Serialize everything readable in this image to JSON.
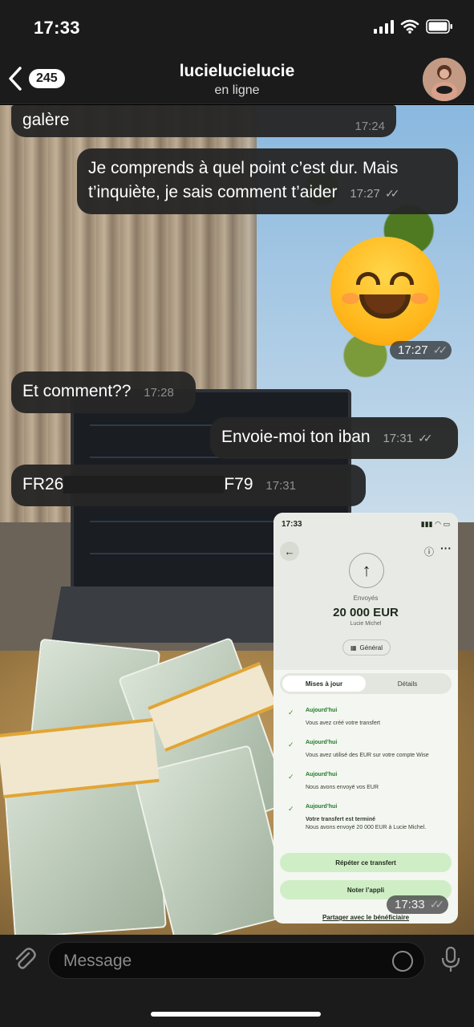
{
  "status_bar": {
    "time": "17:33"
  },
  "header": {
    "back_count": "245",
    "title": "lucielucielucie",
    "subtitle": "en ligne"
  },
  "messages": [
    {
      "direction": "in",
      "text": "galère",
      "time": "17:24"
    },
    {
      "direction": "out",
      "text": "Je comprends à quel point c’est dur. Mais t’inquiète, je sais comment t’aider",
      "time": "17:27",
      "read": true
    },
    {
      "direction": "out",
      "type": "emoji",
      "emoji": "smiling-face",
      "time": "17:27",
      "read": true
    },
    {
      "direction": "in",
      "text": "Et comment??",
      "time": "17:28"
    },
    {
      "direction": "out",
      "text": "Envoie-moi ton iban",
      "time": "17:31",
      "read": true
    },
    {
      "direction": "in",
      "text_start": "FR26",
      "text_end": "F79",
      "redacted": true,
      "time": "17:31"
    },
    {
      "direction": "out",
      "type": "image",
      "time": "17:33",
      "read": true
    }
  ],
  "transfer_screenshot": {
    "status_time": "17:33",
    "sent_label": "Envoyés",
    "amount": "20 000 EUR",
    "recipient": "Lucie Michel",
    "account_tag": "Général",
    "tabs": [
      "Mises à jour",
      "Détails"
    ],
    "steps": [
      {
        "when": "Aujourd’hui",
        "text": "Vous avez créé votre transfert"
      },
      {
        "when": "Aujourd’hui",
        "text": "Vous avez utilisé des EUR sur votre compte Wise"
      },
      {
        "when": "Aujourd’hui",
        "text": "Nous avons envoyé vos EUR"
      },
      {
        "when": "Aujourd’hui",
        "title": "Votre transfert est terminé",
        "text": "Nous avons envoyé 20 000 EUR à Lucie Michel."
      }
    ],
    "buttons": [
      "Répéter ce transfert",
      "Noter l’appli"
    ],
    "link": "Partager avec le bénéficiaire"
  },
  "input": {
    "placeholder": "Message"
  },
  "colors": {
    "bubble": "#262626",
    "background": "#1b1b1b",
    "wise_green": "#cfeec6"
  }
}
